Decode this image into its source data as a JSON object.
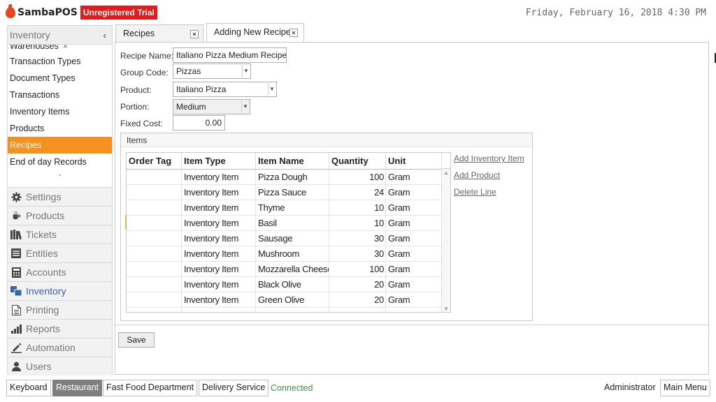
{
  "header": {
    "app_name": "SambaPOS",
    "trial_badge": "Unregistered Trial",
    "datetime": "Friday, February 16, 2018 4:30 PM"
  },
  "sidebar": {
    "section_title": "Inventory",
    "collapse_glyph": "‹",
    "sub_items": [
      {
        "label": "Warehouses",
        "cut": true
      },
      {
        "label": "Transaction Types"
      },
      {
        "label": "Document Types"
      },
      {
        "label": "Transactions"
      },
      {
        "label": "Inventory Items"
      },
      {
        "label": "Products"
      },
      {
        "label": "Recipes",
        "active": true
      },
      {
        "label": "End of day Records"
      }
    ],
    "modules": [
      {
        "label": "Settings",
        "icon": "gear-icon"
      },
      {
        "label": "Products",
        "icon": "coffee-cup-icon"
      },
      {
        "label": "Tickets",
        "icon": "books-icon"
      },
      {
        "label": "Entities",
        "icon": "list-icon"
      },
      {
        "label": "Accounts",
        "icon": "calculator-icon"
      },
      {
        "label": "Inventory",
        "icon": "inventory-icon",
        "active": true
      },
      {
        "label": "Printing",
        "icon": "document-icon"
      },
      {
        "label": "Reports",
        "icon": "bar-chart-icon"
      },
      {
        "label": "Automation",
        "icon": "pen-icon"
      },
      {
        "label": "Users",
        "icon": "user-icon"
      }
    ]
  },
  "tabs": [
    {
      "label": "Recipes",
      "close": "×"
    },
    {
      "label": "Adding New Recipe",
      "close": "×"
    }
  ],
  "form": {
    "recipe_name_label": "Recipe Name:",
    "recipe_name_value": "Italiano Pizza Medium Recipe",
    "group_code_label": "Group Code:",
    "group_code_value": "Pizzas",
    "product_label": "Product:",
    "product_value": "Italiano Pizza",
    "portion_label": "Portion:",
    "portion_value": "Medium",
    "fixed_cost_label": "Fixed Cost:",
    "fixed_cost_value": "0.00"
  },
  "items": {
    "title": "Items",
    "columns": [
      "Order Tag",
      "Item Type",
      "Item Name",
      "Quantity",
      "Unit"
    ],
    "rows": [
      {
        "order_tag": "",
        "item_type": "Inventory Item",
        "item_name": "Pizza Dough",
        "quantity": "100",
        "unit": "Gram"
      },
      {
        "order_tag": "",
        "item_type": "Inventory Item",
        "item_name": "Pizza Sauce",
        "quantity": "24",
        "unit": "Gram"
      },
      {
        "order_tag": "",
        "item_type": "Inventory Item",
        "item_name": "Thyme",
        "quantity": "10",
        "unit": "Gram"
      },
      {
        "order_tag": "",
        "item_type": "Inventory Item",
        "item_name": "Basil",
        "quantity": "10",
        "unit": "Gram"
      },
      {
        "order_tag": "",
        "item_type": "Inventory Item",
        "item_name": "Sausage",
        "quantity": "30",
        "unit": "Gram"
      },
      {
        "order_tag": "",
        "item_type": "Inventory Item",
        "item_name": "Mushroom",
        "quantity": "30",
        "unit": "Gram"
      },
      {
        "order_tag": "",
        "item_type": "Inventory Item",
        "item_name": "Mozzarella Cheese",
        "quantity": "100",
        "unit": "Gram"
      },
      {
        "order_tag": "",
        "item_type": "Inventory Item",
        "item_name": "Black Olive",
        "quantity": "20",
        "unit": "Gram"
      },
      {
        "order_tag": "",
        "item_type": "Inventory Item",
        "item_name": "Green Olive",
        "quantity": "20",
        "unit": "Gram"
      }
    ],
    "actions": [
      "Add Inventory Item",
      "Add Product",
      "Delete Line"
    ]
  },
  "save_label": "Save",
  "bottom_bar": {
    "buttons": [
      {
        "label": "Keyboard"
      },
      {
        "label": "Restaurant",
        "active": true
      },
      {
        "label": "Fast Food Department"
      },
      {
        "label": "Delivery Service"
      }
    ],
    "status": "Connected",
    "user": "Administrator",
    "main_menu": "Main Menu"
  },
  "colors": {
    "accent_orange": "#f5921d",
    "trial_red": "#e21b1b",
    "connected_green": "#3a9a3a",
    "active_module_blue": "#3a66a8"
  }
}
